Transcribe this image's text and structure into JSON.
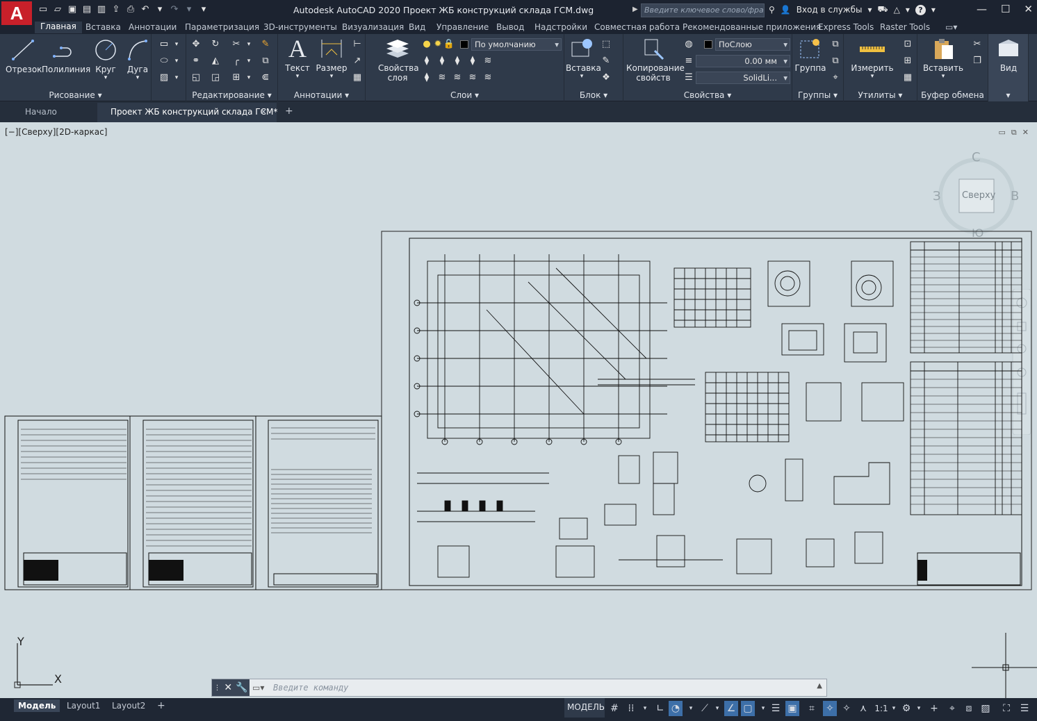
{
  "app": {
    "logo_letter": "A",
    "title": "Autodesk AutoCAD 2020    Проект ЖБ конструкций склада ГСМ.dwg",
    "search_placeholder": "Введите ключевое слово/фразу",
    "signin": "Вход в службы",
    "help": "?"
  },
  "ribbon_tabs": [
    "Главная",
    "Вставка",
    "Аннотации",
    "Параметризация",
    "3D-инструменты",
    "Визуализация",
    "Вид",
    "Управление",
    "Вывод",
    "Надстройки",
    "Совместная работа",
    "Рекомендованные приложения",
    "Express Tools",
    "Raster Tools"
  ],
  "ribbon": {
    "draw": {
      "line": "Отрезок",
      "polyline": "Полилиния",
      "circle": "Круг",
      "arc": "Дуга",
      "panel": "Рисование"
    },
    "modify": {
      "panel": "Редактирование"
    },
    "annotation": {
      "text": "Текст",
      "dimension": "Размер",
      "panel": "Аннотации"
    },
    "layers": {
      "props": "Свойства слоя",
      "current": "По умолчанию",
      "panel": "Слои"
    },
    "block": {
      "insert": "Вставка",
      "panel": "Блок"
    },
    "properties": {
      "match": "Копирование свойств",
      "color": "ПоСлою",
      "lineweight": "0.00 мм",
      "linetype": "SolidLi...",
      "panel": "Свойства"
    },
    "groups": {
      "group": "Группа",
      "panel": "Группы"
    },
    "utilities": {
      "measure": "Измерить",
      "panel": "Утилиты"
    },
    "clipboard": {
      "paste": "Вставить",
      "panel": "Буфер обмена"
    },
    "view": {
      "label": "Вид"
    }
  },
  "doc_tabs": {
    "start": "Начало",
    "active": "Проект ЖБ конструкций склада ГСМ*",
    "close": "✕",
    "add": "+"
  },
  "viewport": {
    "label": "[−][Сверху][2D-каркас]",
    "viewcube": {
      "face": "Сверху",
      "north": "С",
      "south": "Ю",
      "west": "З",
      "east": "В"
    },
    "ucs": {
      "x": "X",
      "y": "Y"
    }
  },
  "command": {
    "placeholder": "Введите команду"
  },
  "layout_tabs": [
    "Модель",
    "Layout1",
    "Layout2"
  ],
  "status": {
    "model": "МОДЕЛЬ",
    "scale": "1:1"
  },
  "colors": {
    "accent": "#c8202a",
    "drawing_bg": "#d0dbe0",
    "ribbon": "#2f3a4a",
    "titlebar": "#1c2330"
  }
}
